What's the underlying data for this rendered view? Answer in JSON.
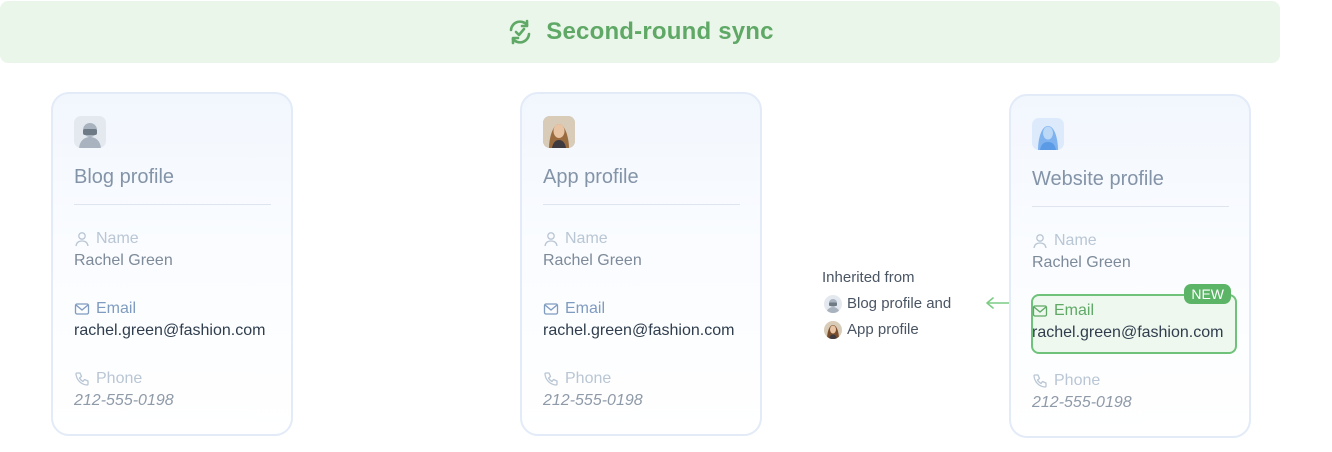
{
  "banner": {
    "title": "Second-round sync",
    "icon": "sync-check-icon",
    "color": "#5fa866"
  },
  "cards": [
    {
      "title": "Blog profile",
      "avatar": "blog-avatar-icon",
      "name_label": "Name",
      "name_value": "Rachel Green",
      "email_label": "Email",
      "email_value": "rachel.green@fashion.com",
      "phone_label": "Phone",
      "phone_value": "212-555-0198"
    },
    {
      "title": "App profile",
      "avatar": "app-avatar-photo",
      "name_label": "Name",
      "name_value": "Rachel Green",
      "email_label": "Email",
      "email_value": "rachel.green@fashion.com",
      "phone_label": "Phone",
      "phone_value": "212-555-0198"
    },
    {
      "title": "Website profile",
      "avatar": "website-avatar-icon",
      "name_label": "Name",
      "name_value": "Rachel Green",
      "email_label": "Email",
      "email_value": "rachel.green@fashion.com",
      "phone_label": "Phone",
      "phone_value": "212-555-0198",
      "new_badge": "NEW"
    }
  ],
  "inherit": {
    "line1": "Inherited from",
    "line2": "Blog profile and",
    "line3": "App profile"
  },
  "colors": {
    "accent_green": "#5cb567",
    "email_blue": "#7f9cc0"
  }
}
